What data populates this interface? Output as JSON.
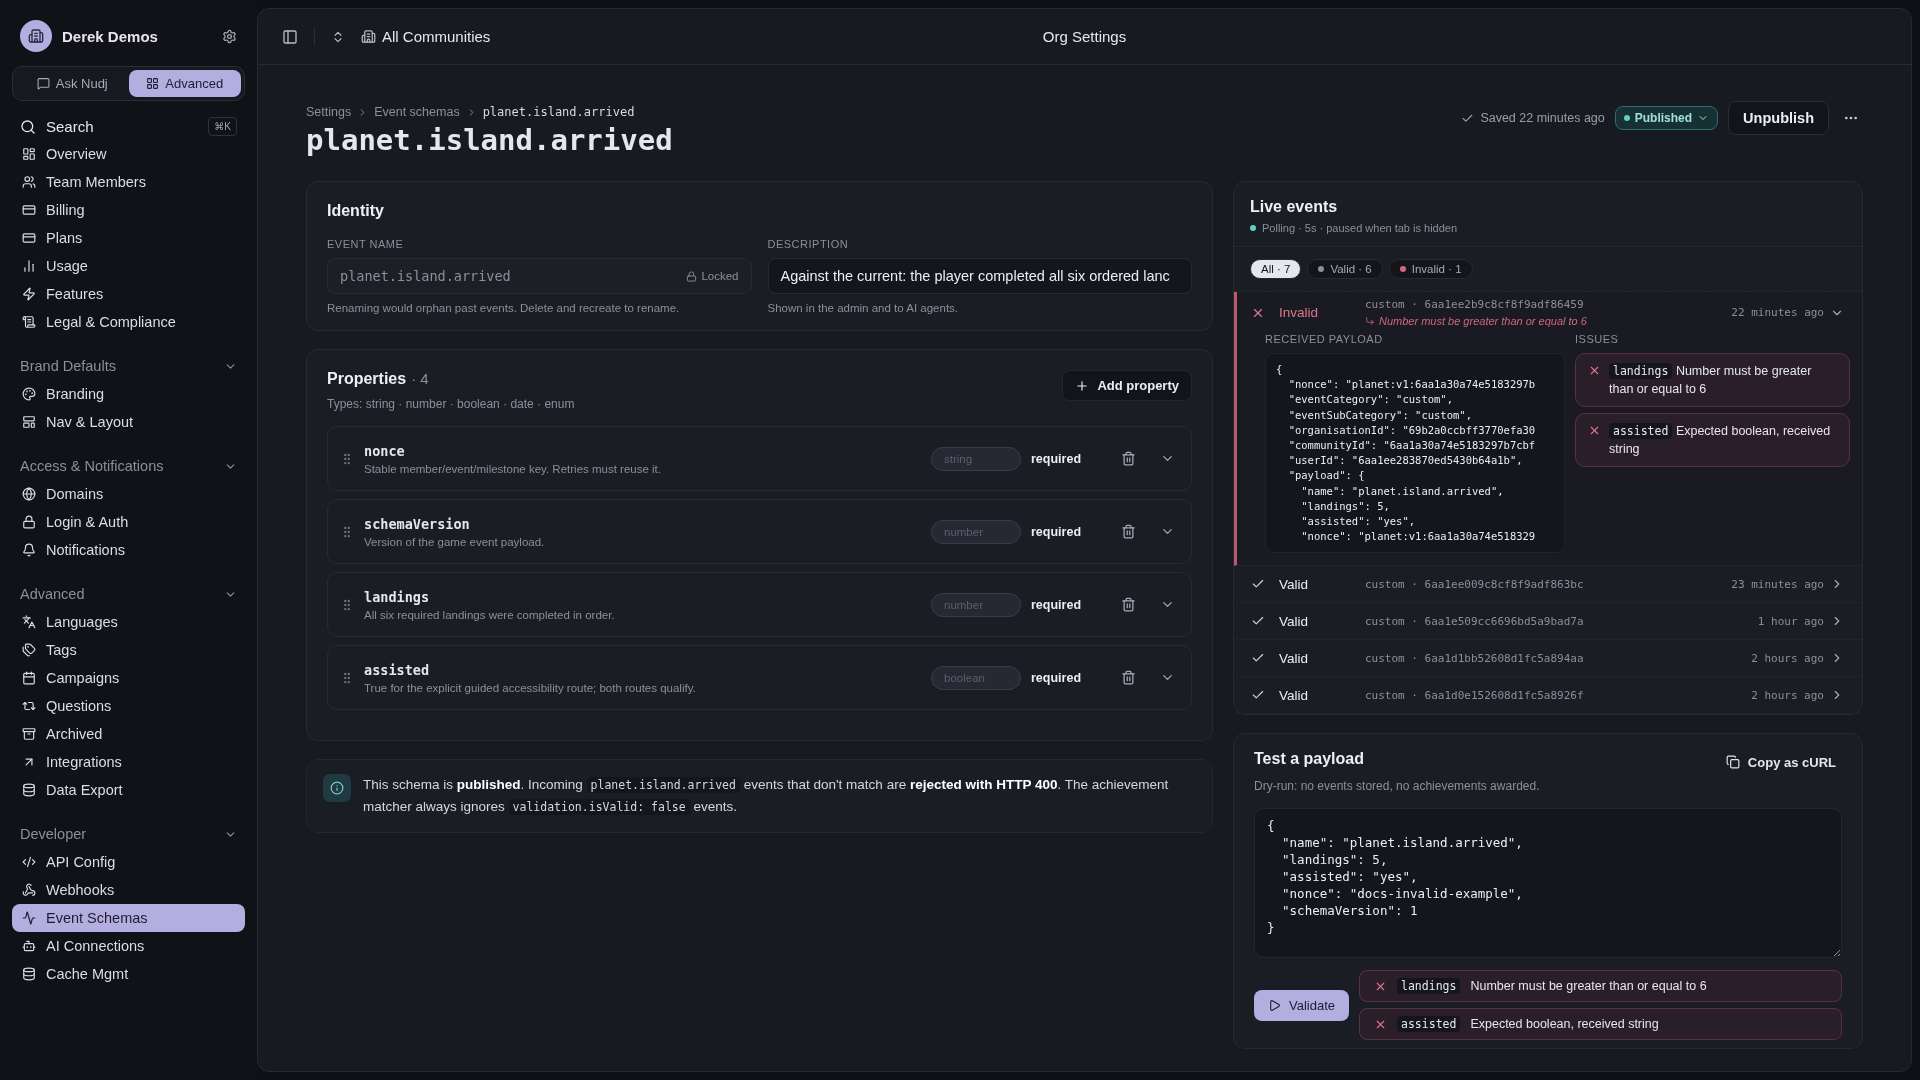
{
  "sidebar": {
    "org": "Derek Demos",
    "modes": [
      {
        "label": "Ask Nudj",
        "selected": false
      },
      {
        "label": "Advanced",
        "selected": true
      }
    ],
    "search": {
      "placeholder": "Search",
      "shortcut": "⌘K"
    },
    "sections": [
      {
        "items": [
          {
            "label": "Overview",
            "selected": false
          },
          {
            "label": "Team Members",
            "selected": false
          },
          {
            "label": "Billing",
            "selected": false
          },
          {
            "label": "Plans",
            "selected": false
          },
          {
            "label": "Usage",
            "selected": false
          },
          {
            "label": "Features",
            "selected": false
          },
          {
            "label": "Legal & Compliance",
            "selected": false
          }
        ]
      },
      {
        "title": "Brand Defaults",
        "expanded": true,
        "items": [
          {
            "label": "Branding",
            "selected": false
          },
          {
            "label": "Nav & Layout",
            "selected": false
          }
        ]
      },
      {
        "title": "Access & Notifications",
        "expanded": true,
        "items": [
          {
            "label": "Domains",
            "selected": false
          },
          {
            "label": "Login & Auth",
            "selected": false
          },
          {
            "label": "Notifications",
            "selected": false
          }
        ]
      },
      {
        "title": "Advanced",
        "expanded": true,
        "items": [
          {
            "label": "Languages",
            "selected": false
          },
          {
            "label": "Tags",
            "selected": false
          },
          {
            "label": "Campaigns",
            "selected": false
          },
          {
            "label": "Questions",
            "selected": false
          },
          {
            "label": "Archived",
            "selected": false
          },
          {
            "label": "Integrations",
            "selected": false
          },
          {
            "label": "Data Export",
            "selected": false
          }
        ]
      },
      {
        "title": "Developer",
        "expanded": true,
        "items": [
          {
            "label": "API Config",
            "selected": false
          },
          {
            "label": "Webhooks",
            "selected": false
          },
          {
            "label": "Event Schemas",
            "selected": true
          },
          {
            "label": "AI Connections",
            "selected": false
          },
          {
            "label": "Cache Mgmt",
            "selected": false
          }
        ]
      }
    ]
  },
  "top_bar": {
    "community": "All Communities",
    "title": "Org Settings"
  },
  "page": {
    "breadcrumb": [
      "Settings",
      "Event schemas",
      "planet.island.arrived"
    ],
    "title": "planet.island.arrived",
    "saved": "Saved 22 minutes ago",
    "status": "Published",
    "unpublish": "Unpublish"
  },
  "identity": {
    "title": "Identity",
    "event_name": {
      "label": "EVENT NAME",
      "value": "planet.island.arrived",
      "lock": "Locked",
      "hint": "Renaming would orphan past events. Delete and recreate to rename."
    },
    "description": {
      "label": "DESCRIPTION",
      "value": "Against the current: the player completed all six ordered lanc",
      "hint": "Shown in the admin and to AI agents."
    }
  },
  "properties": {
    "title": "Properties",
    "count": "· 4",
    "types": "Types: string · number · boolean · date · enum",
    "add": "Add property",
    "rows": [
      {
        "name": "nonce",
        "description": "Stable member/event/milestone key. Retries must reuse it.",
        "type": "string",
        "requirement": "required"
      },
      {
        "name": "schemaVersion",
        "description": "Version of the game event payload.",
        "type": "number",
        "requirement": "required"
      },
      {
        "name": "landings",
        "description": "All six required landings were completed in order.",
        "type": "number",
        "requirement": "required"
      },
      {
        "name": "assisted",
        "description": "True for the explicit guided accessibility route; both routes qualify.",
        "type": "boolean",
        "requirement": "required"
      }
    ]
  },
  "notice": [
    {
      "kind": "text",
      "text": "This schema is **published**. Incoming "
    },
    {
      "kind": "code",
      "text": "planet.island.arrived"
    },
    {
      "kind": "text",
      "text": " events that don't match are **rejected with HTTP 400**. The achievement matcher always ignores "
    },
    {
      "kind": "code",
      "text": "validation.isValid: false"
    },
    {
      "kind": "text",
      "text": " events."
    }
  ],
  "live_events": {
    "title": "Live events",
    "polling": "Polling · 5s · paused when tab is hidden",
    "filters": [
      {
        "label": "All · 7",
        "selected": true
      },
      {
        "label": "Valid · 6",
        "selected": false,
        "color": "#8d8f99"
      },
      {
        "label": "Invalid · 1",
        "selected": false,
        "color": "#d06a80"
      }
    ],
    "events": [
      {
        "kind": "invalid",
        "label": "Invalid",
        "source": "custom · 6aa1ee2b9c8cf8f9adf86459",
        "note": "Number must be greater than or equal to 6",
        "time": "22 minutes ago",
        "expanded": true,
        "payload_label": "RECEIVED PAYLOAD",
        "payload": [
          "{",
          "  \"nonce\": \"planet:v1:6aa1a30a74e5183297b",
          "  \"eventCategory\": \"custom\",",
          "  \"eventSubCategory\": \"custom\",",
          "  \"organisationId\": \"69b2a0ccbff3770efa30",
          "  \"communityId\": \"6aa1a30a74e5183297b7cbf",
          "  \"userId\": \"6aa1ee283870ed5430b64a1b\",",
          "  \"payload\": {",
          "    \"name\": \"planet.island.arrived\",",
          "    \"landings\": 5,",
          "    \"assisted\": \"yes\",",
          "    \"nonce\": \"planet:v1:6aa1a30a74e518329"
        ],
        "issues_label": "ISSUES",
        "issues": [
          {
            "field": "landings",
            "message": "Number must be greater than or equal to 6"
          },
          {
            "field": "assisted",
            "message": "Expected boolean, received string"
          }
        ]
      },
      {
        "kind": "valid",
        "label": "Valid",
        "source": "custom · 6aa1ee009c8cf8f9adf863bc",
        "time": "23 minutes ago",
        "expanded": false
      },
      {
        "kind": "valid",
        "label": "Valid",
        "source": "custom · 6aa1e509cc6696bd5a9bad7a",
        "time": "1 hour ago",
        "expanded": false
      },
      {
        "kind": "valid",
        "label": "Valid",
        "source": "custom · 6aa1d1bb52608d1fc5a894aa",
        "time": "2 hours ago",
        "expanded": false
      },
      {
        "kind": "valid",
        "label": "Valid",
        "source": "custom · 6aa1d0e152608d1fc5a8926f",
        "time": "2 hours ago",
        "expanded": false
      }
    ]
  },
  "test_payload": {
    "title": "Test a payload",
    "subtitle": "Dry-run: no events stored, no achievements awarded.",
    "copy": "Copy as cURL",
    "value": "{\n  \"name\": \"planet.island.arrived\",\n  \"landings\": 5,\n  \"assisted\": \"yes\",\n  \"nonce\": \"docs-invalid-example\",\n  \"schemaVersion\": 1\n}",
    "validate": "Validate",
    "results": [
      {
        "field": "landings",
        "message": "Number must be greater than or equal to 6"
      },
      {
        "field": "assisted",
        "message": "Expected boolean, received string"
      }
    ]
  }
}
